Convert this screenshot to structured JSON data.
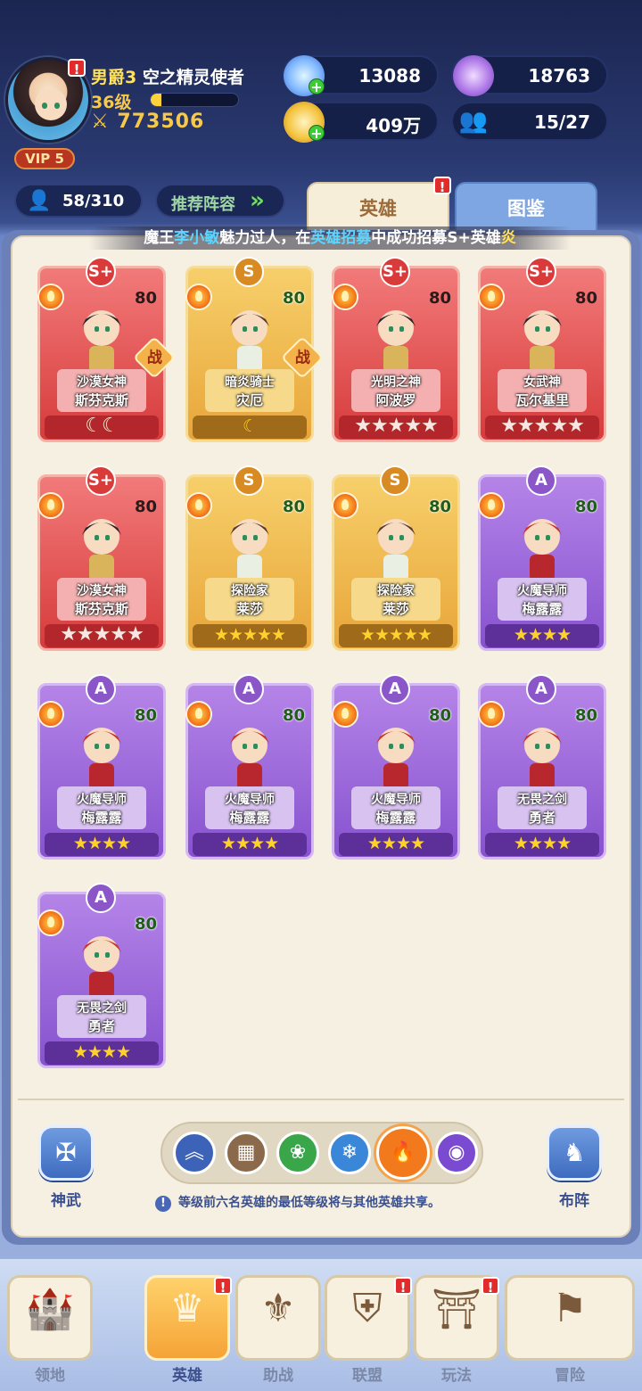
{
  "player": {
    "title_rank": "男爵3",
    "title_name": "空之精灵使者",
    "level_text": "36级",
    "level_progress": 0.12,
    "power": "773506",
    "vip": "VIP 5"
  },
  "resources": {
    "crystal": "13088",
    "gem": "18763",
    "gold": "409万",
    "team": "15/27"
  },
  "toolbar": {
    "hero_count": "58/310",
    "recommend_label": "推荐阵容"
  },
  "tabs": {
    "hero": "英雄",
    "dex": "图鉴"
  },
  "marquee": {
    "part1": "魔王",
    "player_name": "李小敏",
    "part2": "魅力过人，在",
    "event": "英雄招募",
    "part3": "中成功招募S+英雄",
    "tail": "炎"
  },
  "heroes": [
    {
      "grade": "S+",
      "level": "80",
      "title": "沙漠女神",
      "name": "斯芬克斯",
      "stars": "☾☾",
      "battle": "战"
    },
    {
      "grade": "S",
      "level": "80",
      "title": "暗炎骑士",
      "name": "灾厄",
      "stars": "☾",
      "battle": "战"
    },
    {
      "grade": "S+",
      "level": "80",
      "title": "光明之神",
      "name": "阿波罗",
      "stars": "★★★★★"
    },
    {
      "grade": "S+",
      "level": "80",
      "title": "女武神",
      "name": "瓦尔基里",
      "stars": "★★★★★"
    },
    {
      "grade": "S+",
      "level": "80",
      "title": "沙漠女神",
      "name": "斯芬克斯",
      "stars": "★★★★★"
    },
    {
      "grade": "S",
      "level": "80",
      "title": "探险家",
      "name": "莱莎",
      "stars": "★★★★★"
    },
    {
      "grade": "S",
      "level": "80",
      "title": "探险家",
      "name": "莱莎",
      "stars": "★★★★★"
    },
    {
      "grade": "A",
      "level": "80",
      "title": "火魔导师",
      "name": "梅露露",
      "stars": "★★★★"
    },
    {
      "grade": "A",
      "level": "80",
      "title": "火魔导师",
      "name": "梅露露",
      "stars": "★★★★"
    },
    {
      "grade": "A",
      "level": "80",
      "title": "火魔导师",
      "name": "梅露露",
      "stars": "★★★★"
    },
    {
      "grade": "A",
      "level": "80",
      "title": "火魔导师",
      "name": "梅露露",
      "stars": "★★★★"
    },
    {
      "grade": "A",
      "level": "80",
      "title": "无畏之剑",
      "name": "勇者",
      "stars": "★★★★"
    },
    {
      "grade": "A",
      "level": "80",
      "title": "无畏之剑",
      "name": "勇者",
      "stars": "★★★★"
    }
  ],
  "panel_bottom": {
    "left_label": "神武",
    "right_label": "布阵",
    "hint": "等级前六名英雄的最低等级将与其他英雄共享。"
  },
  "nav": {
    "territory": "领地",
    "hero": "英雄",
    "support": "助战",
    "alliance": "联盟",
    "gameplay": "玩法",
    "adventure": "冒险"
  },
  "colors": {
    "splus": "#d73b3b",
    "s": "#e8a63a",
    "a": "#8752cf",
    "fire_active": "#f5a24a"
  }
}
